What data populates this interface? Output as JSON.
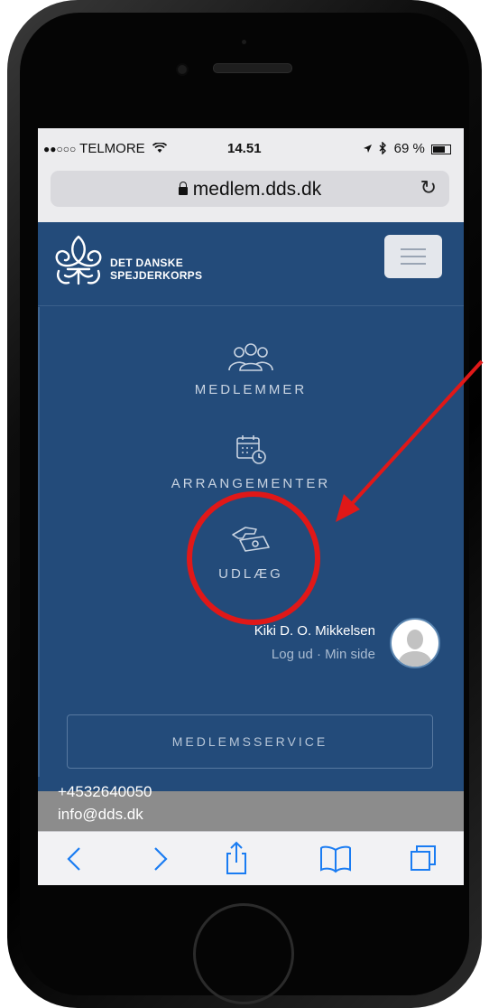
{
  "status_bar": {
    "signal_dots": "●●○○○",
    "carrier": "TELMORE",
    "time": "14.51",
    "battery": "69 %"
  },
  "browser": {
    "url": "medlem.dds.dk",
    "reload_glyph": "↻"
  },
  "site": {
    "logo_line1": "DET DANSKE",
    "logo_line2": "SPEJDERKORPS"
  },
  "nav": {
    "members_label": "MEDLEMMER",
    "events_label": "ARRANGEMENTER",
    "expenses_label": "UDLÆG"
  },
  "user": {
    "name": "Kiki D. O. Mikkelsen",
    "logout": "Log ud",
    "separator": " · ",
    "my_page": "Min side"
  },
  "service_button": "MEDLEMSSERVICE",
  "footer": {
    "phone": "+4532640050",
    "email": "info@dds.dk"
  },
  "toolbar": {
    "back": "back-icon",
    "forward": "forward-icon",
    "share": "share-icon",
    "bookmarks": "bookmarks-icon",
    "tabs": "tabs-icon"
  },
  "colors": {
    "page_bg": "#234b7a",
    "ios_accent": "#1a7cf2",
    "annotation_red": "#e01818"
  }
}
